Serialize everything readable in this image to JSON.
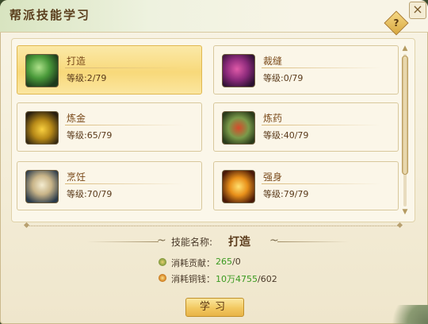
{
  "window": {
    "title": "帮派技能学习",
    "close_label": "×",
    "help_label": "?"
  },
  "skills": [
    {
      "name": "打造",
      "level_label": "等级:",
      "level": "2/79",
      "icon": "forging-hammer-icon",
      "selected": true
    },
    {
      "name": "裁缝",
      "level_label": "等级:",
      "level": "0/79",
      "icon": "sewing-thread-icon",
      "selected": false
    },
    {
      "name": "炼金",
      "level_label": "等级:",
      "level": "65/79",
      "icon": "alchemy-flask-icon",
      "selected": false
    },
    {
      "name": "炼药",
      "level_label": "等级:",
      "level": "40/79",
      "icon": "herbal-medicine-icon",
      "selected": false
    },
    {
      "name": "烹饪",
      "level_label": "等级:",
      "level": "70/79",
      "icon": "dumpling-steamer-icon",
      "selected": false
    },
    {
      "name": "强身",
      "level_label": "等级:",
      "level": "79/79",
      "icon": "fiery-strength-icon",
      "selected": false
    }
  ],
  "detail": {
    "name_label": "技能名称:",
    "name_value": "打造",
    "contribution_label": "消耗贡献：",
    "contribution_have": "265",
    "contribution_need": "/0",
    "money_label": "消耗铜钱：",
    "money_have": "10万4755",
    "money_need": "/602"
  },
  "learn_button": "学习",
  "colors": {
    "panel_bg": "#f8f4e6",
    "selected_card": "#f8d97a",
    "title_text": "#5a3e1c",
    "value_green": "#3a9a20"
  }
}
